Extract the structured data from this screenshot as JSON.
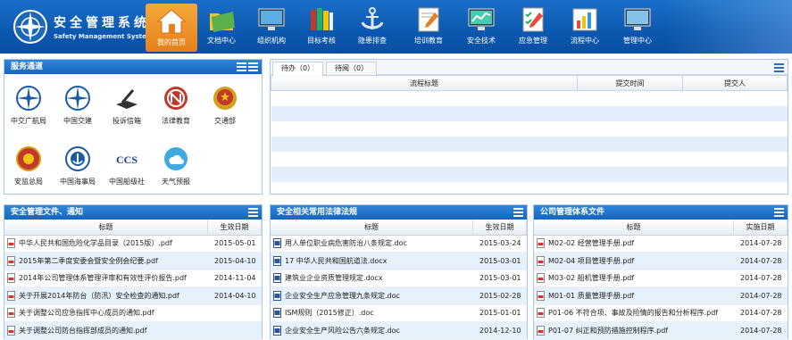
{
  "brand": {
    "title": "安全管理系统",
    "subtitle": "Safety Management Systems"
  },
  "nav": [
    "我的首页",
    "文档中心",
    "组织机构",
    "目标考核",
    "隐患排查",
    "培训教育",
    "安全技术",
    "应急管理",
    "流程中心",
    "管理中心"
  ],
  "services": {
    "title": "服务通道",
    "items": [
      "中交广航局",
      "中国交建",
      "投诉信箱",
      "法律教育",
      "交通部",
      "安监总局",
      "中国海事局",
      "中国船级社",
      "天气预报"
    ]
  },
  "workflow": {
    "tabs": [
      "待办（0）",
      "待阅（0）"
    ],
    "columns": [
      "流程标题",
      "提交时间",
      "提交人"
    ]
  },
  "panels": [
    {
      "title": "安全管理文件、通知",
      "columns": [
        "标题",
        "生效日期"
      ],
      "rows": [
        {
          "icon": "pdf-icon",
          "title": "中华人民共和国危险化学品目录（2015版）.pdf",
          "date": "2015-05-01"
        },
        {
          "icon": "pdf-icon",
          "title": "2015年第二季度安委会暨安全例会纪要.pdf",
          "date": "2015-04-10"
        },
        {
          "icon": "pdf-icon",
          "title": "2014年公司管理体系管理评审和有效性评价报告.pdf",
          "date": "2014-11-04"
        },
        {
          "icon": "pdf-icon",
          "title": "关于开展2014年防台（防汛）安全检查的通知.pdf",
          "date": "2014-04-10"
        },
        {
          "icon": "pdf-icon",
          "title": "关于调整公司应急指挥中心成员的通知.pdf",
          "date": ""
        },
        {
          "icon": "pdf-icon",
          "title": "关于调整公司防台指挥部成员的通知.pdf",
          "date": ""
        }
      ]
    },
    {
      "title": "安全相关常用法律法规",
      "columns": [
        "标题",
        "生效日期"
      ],
      "rows": [
        {
          "icon": "doc-icon",
          "title": "用人单位职业病危害防治八条规定.doc",
          "date": "2015-03-24"
        },
        {
          "icon": "doc-icon",
          "title": "17 中华人民共和国航道法.docx",
          "date": "2015-03-01"
        },
        {
          "icon": "doc-icon",
          "title": "建筑业企业资质管理规定.docx",
          "date": "2015-03-01"
        },
        {
          "icon": "doc-icon",
          "title": "企业安全生产应急管理九条规定.doc",
          "date": "2015-02-28"
        },
        {
          "icon": "doc-icon",
          "title": "ISM规则（2015修正）.doc",
          "date": "2015-01-01"
        },
        {
          "icon": "doc-icon",
          "title": "企业安全生产风险公告六条规定.doc",
          "date": "2014-12-10"
        }
      ]
    },
    {
      "title": "公司管理体系文件",
      "columns": [
        "标题",
        "实施日期"
      ],
      "rows": [
        {
          "icon": "pdf-icon",
          "title": "M02-02 经营管理手册.pdf",
          "date": "2014-07-28"
        },
        {
          "icon": "pdf-icon",
          "title": "M02-04 项目管理手册.pdf",
          "date": "2014-07-28"
        },
        {
          "icon": "pdf-icon",
          "title": "M03-02 船机管理手册.pdf",
          "date": "2014-07-28"
        },
        {
          "icon": "pdf-icon",
          "title": "M01-01 质量管理手册.pdf",
          "date": "2014-07-28"
        },
        {
          "icon": "pdf-icon",
          "title": "P01-06 不符合项、事故及险情的报告和分析程序.pdf",
          "date": "2014-07-28"
        },
        {
          "icon": "pdf-icon",
          "title": "P01-07 纠正和预防措施控制程序.pdf",
          "date": "2014-07-28"
        }
      ]
    }
  ]
}
